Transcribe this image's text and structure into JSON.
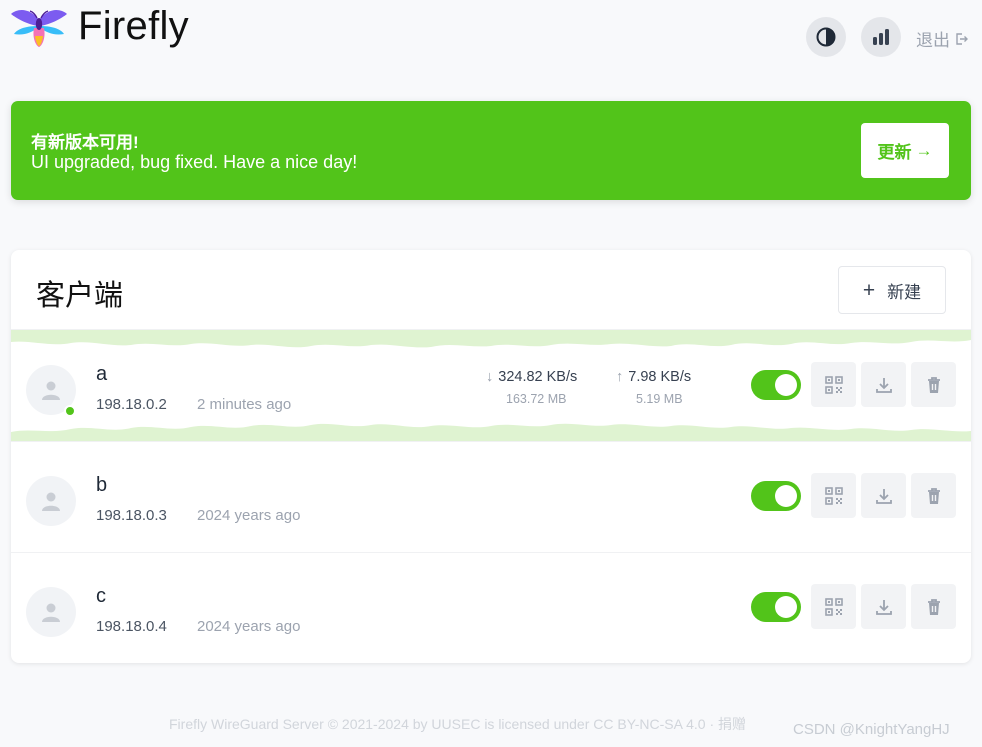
{
  "header": {
    "title": "Firefly",
    "logout_label": "退出"
  },
  "banner": {
    "title": "有新版本可用!",
    "description": "UI upgraded, bug fixed. Have a nice day!",
    "update_label": "更新",
    "color": "#52c41a"
  },
  "clients": {
    "title": "客户端",
    "new_label": "新建",
    "items": [
      {
        "name": "a",
        "ip": "198.18.0.2",
        "time": "2 minutes ago",
        "online": true,
        "enabled": true,
        "download_rate": "324.82 KB/s",
        "download_total": "163.72 MB",
        "upload_rate": "7.98 KB/s",
        "upload_total": "5.19 MB"
      },
      {
        "name": "b",
        "ip": "198.18.0.3",
        "time": "2024 years ago",
        "online": false,
        "enabled": true
      },
      {
        "name": "c",
        "ip": "198.18.0.4",
        "time": "2024 years ago",
        "online": false,
        "enabled": true
      }
    ]
  },
  "footer": {
    "text": "Firefly WireGuard Server © 2021-2024 by UUSEC is licensed under CC BY-NC-SA 4.0 · 捐赠"
  },
  "watermark": "CSDN @KnightYangHJ"
}
